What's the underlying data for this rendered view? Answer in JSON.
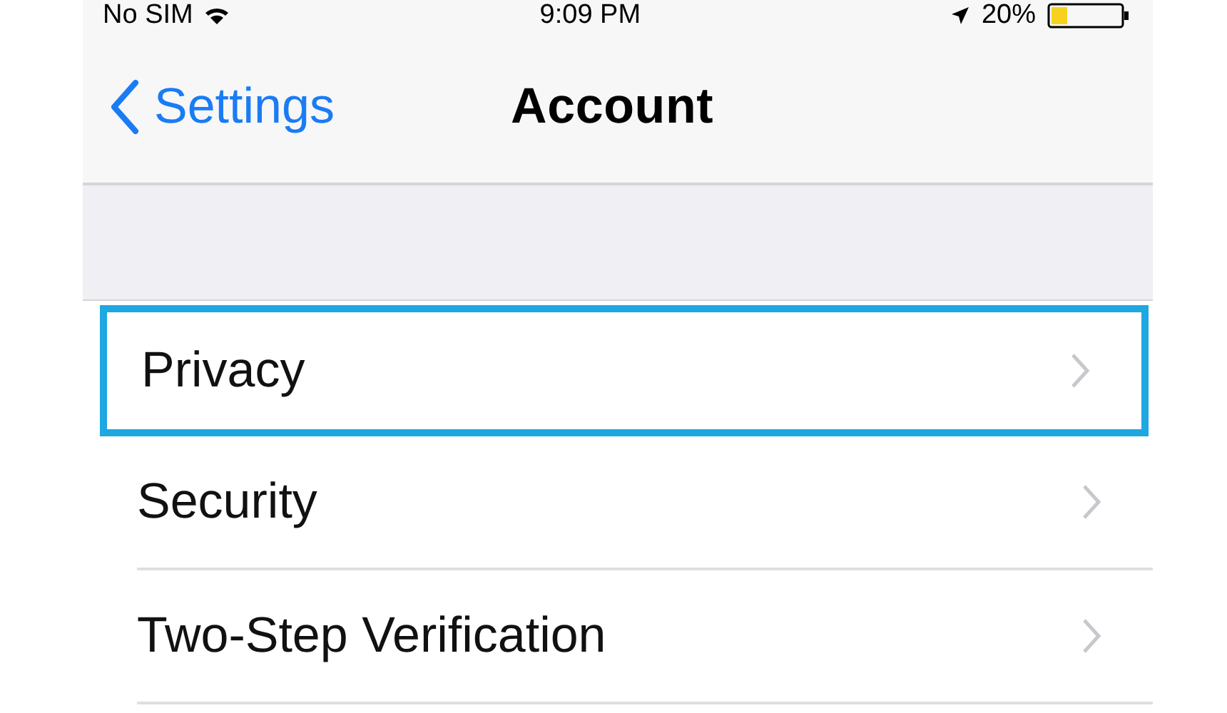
{
  "status_bar": {
    "carrier": "No SIM",
    "time": "9:09 PM",
    "battery": "20%"
  },
  "nav_bar": {
    "back": "Settings",
    "title": "Account"
  },
  "items": [
    {
      "label": "Privacy",
      "selected": true
    },
    {
      "label": "Security",
      "selected": false
    },
    {
      "label": "Two-Step Verification",
      "selected": false
    }
  ]
}
